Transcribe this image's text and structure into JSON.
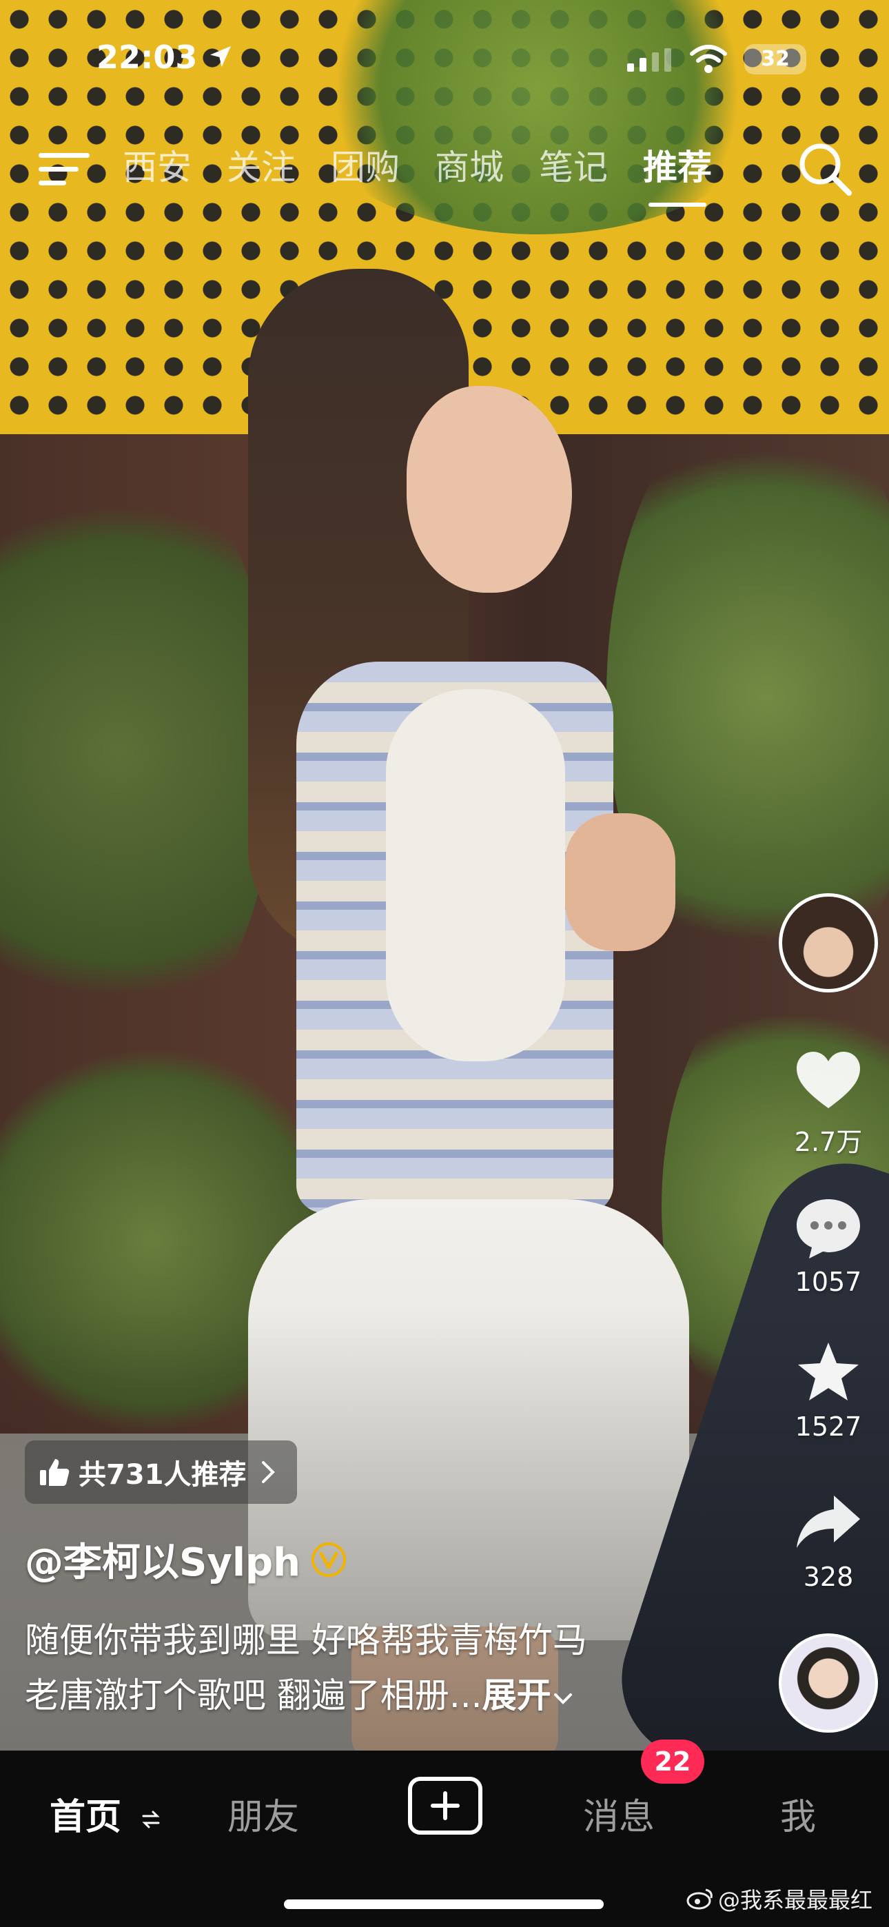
{
  "status_bar": {
    "time": "22:03",
    "battery": "32"
  },
  "top_nav": {
    "tabs": [
      {
        "label": "西安",
        "active": false
      },
      {
        "label": "关注",
        "active": false
      },
      {
        "label": "团购",
        "active": false
      },
      {
        "label": "商城",
        "active": false
      },
      {
        "label": "笔记",
        "active": false
      },
      {
        "label": "推荐",
        "active": true
      }
    ]
  },
  "right_rail": {
    "likes": "2.7万",
    "comments": "1057",
    "favorites": "1527",
    "shares": "328"
  },
  "video": {
    "recommend_text": "共731人推荐",
    "author": "@李柯以Sylph",
    "caption_line1": "随便你带我到哪里 好咯帮我青梅竹马",
    "caption_line2": "老唐澈打个歌吧 翻遍了相册...",
    "expand_label": "展开"
  },
  "tab_bar": {
    "home": "首页",
    "friends": "朋友",
    "messages": "消息",
    "messages_badge": "22",
    "me": "我"
  },
  "watermark": "@我系最最最红",
  "colors": {
    "badge": "#ff2a55",
    "verified": "#f0b400"
  }
}
